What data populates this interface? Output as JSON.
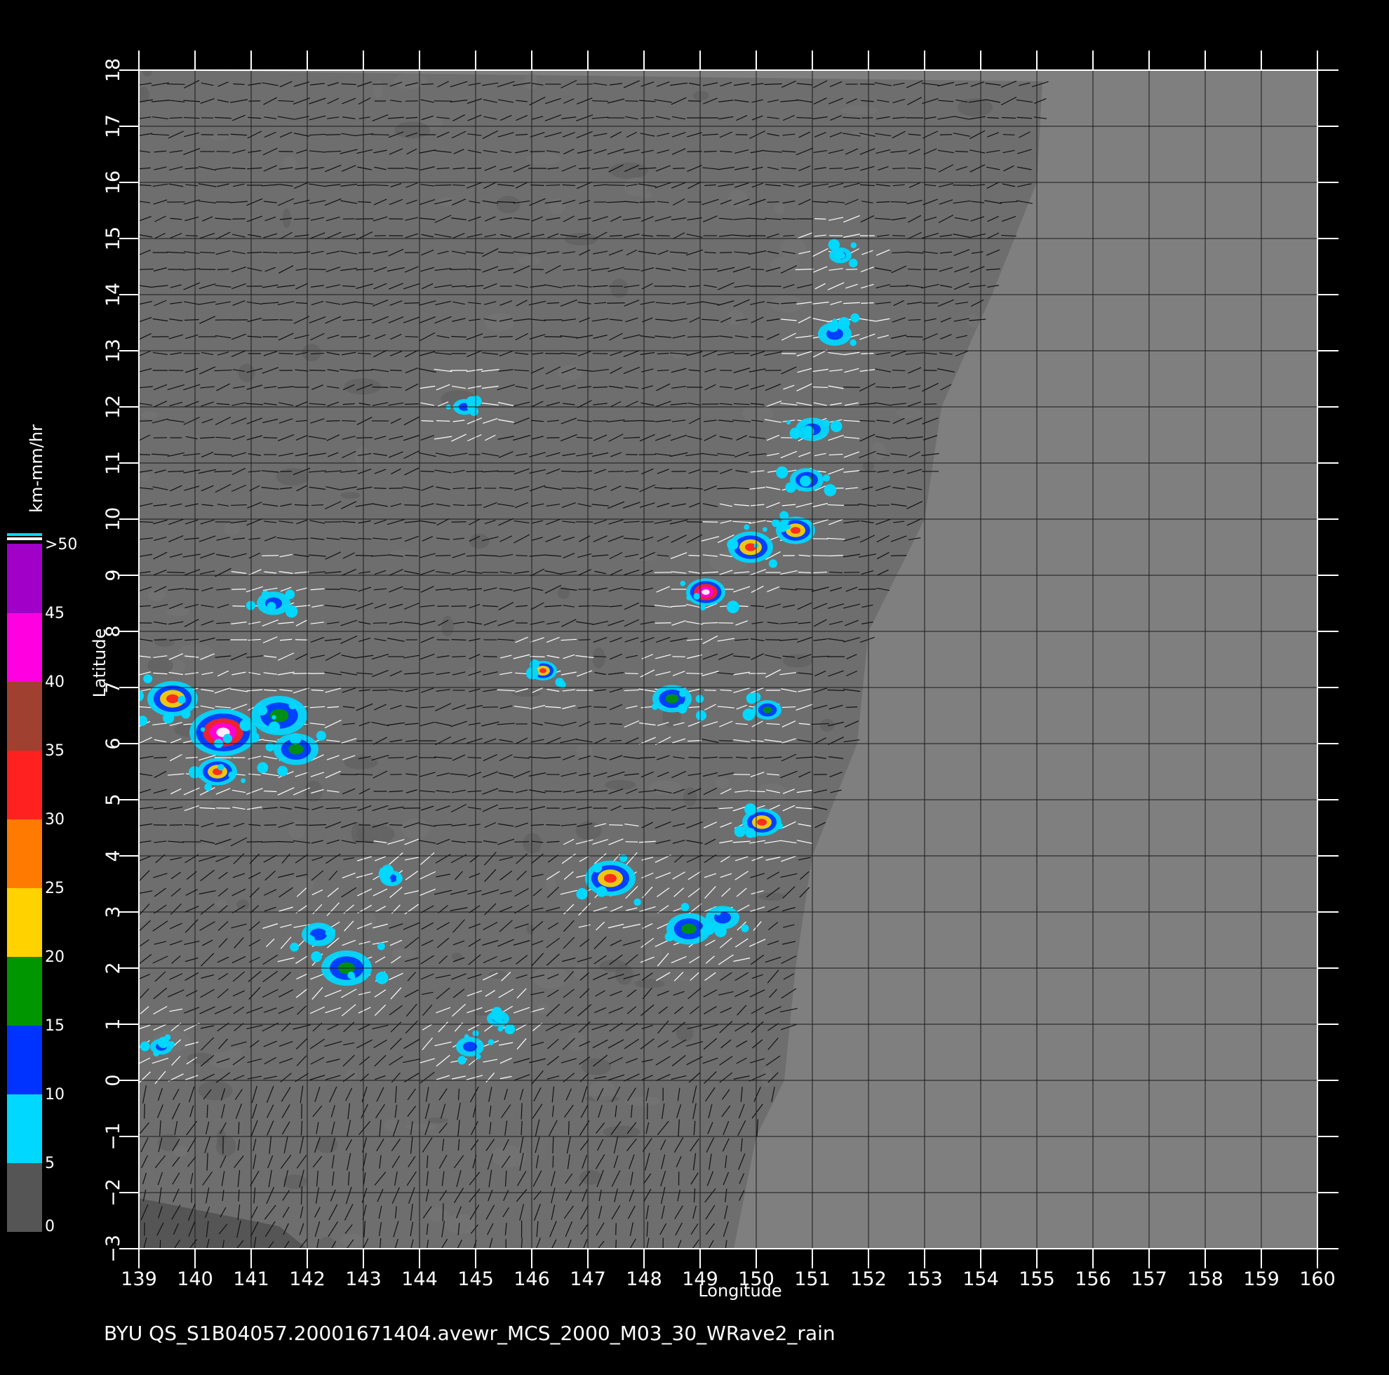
{
  "map": {
    "background_color": "#000000",
    "ocean_color": "#7f7f7f",
    "grid_color": "#1a1a1a",
    "x_axis": {
      "title": "Longitude",
      "range": [
        139,
        160
      ],
      "ticks": [
        "139",
        "140",
        "141",
        "142",
        "143",
        "144",
        "145",
        "146",
        "147",
        "148",
        "149",
        "150",
        "151",
        "152",
        "153",
        "154",
        "155",
        "156",
        "157",
        "158",
        "159",
        "160"
      ]
    },
    "y_axis": {
      "title": "Latitude",
      "range": [
        -3,
        18
      ],
      "ticks": [
        "−3",
        "−2",
        "−1",
        "0",
        "1",
        "2",
        "3",
        "4",
        "5",
        "6",
        "7",
        "8",
        "9",
        "10",
        "11",
        "12",
        "13",
        "14",
        "15",
        "16",
        "17",
        "18"
      ]
    },
    "swath_east_edge": [
      [
        17.8,
        155.1
      ],
      [
        16,
        155
      ],
      [
        14,
        154.2
      ],
      [
        12,
        153.3
      ],
      [
        10,
        153
      ],
      [
        8,
        152
      ],
      [
        6,
        151.8
      ],
      [
        4,
        151
      ],
      [
        2,
        150.7
      ],
      [
        0,
        150.5
      ],
      [
        -1,
        150
      ],
      [
        -3,
        149.6
      ]
    ],
    "rain_cells": [
      {
        "lon": 139.6,
        "lat": 6.8,
        "r": 0.45,
        "level": "heavy"
      },
      {
        "lon": 140.5,
        "lat": 6.2,
        "r": 0.6,
        "level": "extreme"
      },
      {
        "lon": 140.4,
        "lat": 5.5,
        "r": 0.35,
        "level": "heavy"
      },
      {
        "lon": 141.5,
        "lat": 6.5,
        "r": 0.5,
        "level": "moderate"
      },
      {
        "lon": 141.8,
        "lat": 5.9,
        "r": 0.4,
        "level": "moderate"
      },
      {
        "lon": 141.4,
        "lat": 8.5,
        "r": 0.3,
        "level": "light"
      },
      {
        "lon": 142.7,
        "lat": 2.0,
        "r": 0.45,
        "level": "moderate"
      },
      {
        "lon": 142.2,
        "lat": 2.6,
        "r": 0.3,
        "level": "light"
      },
      {
        "lon": 143.5,
        "lat": 3.6,
        "r": 0.2,
        "level": "light"
      },
      {
        "lon": 144.8,
        "lat": 12.0,
        "r": 0.2,
        "level": "light"
      },
      {
        "lon": 146.2,
        "lat": 7.3,
        "r": 0.25,
        "level": "heavy"
      },
      {
        "lon": 147.4,
        "lat": 3.6,
        "r": 0.45,
        "level": "heavy"
      },
      {
        "lon": 148.5,
        "lat": 6.8,
        "r": 0.35,
        "level": "moderate"
      },
      {
        "lon": 148.8,
        "lat": 2.7,
        "r": 0.4,
        "level": "moderate"
      },
      {
        "lon": 149.4,
        "lat": 2.9,
        "r": 0.3,
        "level": "light"
      },
      {
        "lon": 150.1,
        "lat": 4.6,
        "r": 0.35,
        "level": "heavy"
      },
      {
        "lon": 149.1,
        "lat": 8.7,
        "r": 0.35,
        "level": "extreme"
      },
      {
        "lon": 149.9,
        "lat": 9.5,
        "r": 0.4,
        "level": "heavy"
      },
      {
        "lon": 150.7,
        "lat": 9.8,
        "r": 0.35,
        "level": "heavy"
      },
      {
        "lon": 150.9,
        "lat": 10.7,
        "r": 0.3,
        "level": "moderate"
      },
      {
        "lon": 151.0,
        "lat": 11.6,
        "r": 0.3,
        "level": "light"
      },
      {
        "lon": 151.4,
        "lat": 13.3,
        "r": 0.3,
        "level": "light"
      },
      {
        "lon": 151.5,
        "lat": 14.7,
        "r": 0.2,
        "level": "light"
      },
      {
        "lon": 150.2,
        "lat": 6.6,
        "r": 0.25,
        "level": "moderate"
      },
      {
        "lon": 145.4,
        "lat": 1.1,
        "r": 0.2,
        "level": "light"
      },
      {
        "lon": 144.9,
        "lat": 0.6,
        "r": 0.25,
        "level": "light"
      },
      {
        "lon": 139.4,
        "lat": 0.6,
        "r": 0.2,
        "level": "light"
      }
    ]
  },
  "legend": {
    "title": "km-mm/hr",
    "labels": [
      "0",
      "5",
      "10",
      "15",
      "20",
      "25",
      "30",
      "35",
      "40",
      "45",
      ">50"
    ],
    "bands": [
      {
        "from": 0,
        "to": 5,
        "color": "#555555"
      },
      {
        "from": 5,
        "to": 10,
        "color": "#00d8ff"
      },
      {
        "from": 10,
        "to": 15,
        "color": "#0033ff"
      },
      {
        "from": 15,
        "to": 20,
        "color": "#009600"
      },
      {
        "from": 20,
        "to": 25,
        "color": "#ffd200"
      },
      {
        "from": 25,
        "to": 30,
        "color": "#ff7a00"
      },
      {
        "from": 30,
        "to": 35,
        "color": "#ff2020"
      },
      {
        "from": 35,
        "to": 40,
        "color": "#a04030"
      },
      {
        "from": 40,
        "to": 45,
        "color": "#ff00e0"
      },
      {
        "from": 45,
        "to": 50,
        "color": "#a000c8"
      }
    ]
  },
  "footer": {
    "caption": "BYU  QS_S1B04057.20001671404.avewr_MCS_2000_M03_30_WRave2_rain"
  }
}
